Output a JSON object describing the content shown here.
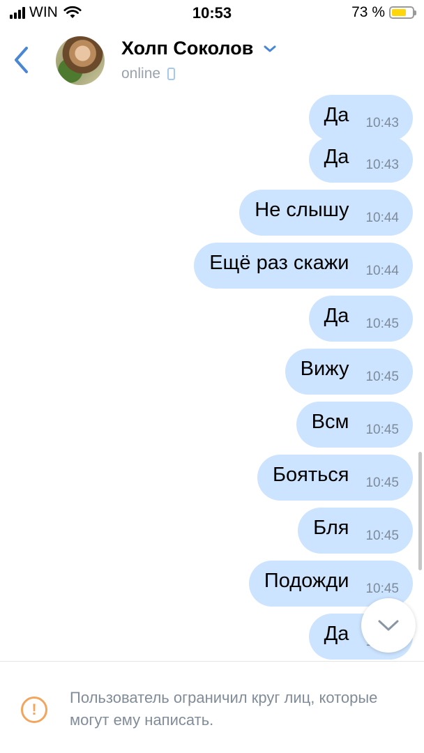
{
  "status_bar": {
    "carrier": "WIN",
    "time": "10:53",
    "battery_percent": "73 %",
    "battery_level": 0.73
  },
  "header": {
    "contact_name": "Холп Соколов",
    "status": "online"
  },
  "messages": [
    {
      "text": "Да",
      "time": "10:43"
    },
    {
      "text": "Да",
      "time": "10:43"
    },
    {
      "text": "Не слышу",
      "time": "10:44"
    },
    {
      "text": "Ещё раз скажи",
      "time": "10:44"
    },
    {
      "text": "Да",
      "time": "10:45"
    },
    {
      "text": "Вижу",
      "time": "10:45"
    },
    {
      "text": "Всм",
      "time": "10:45"
    },
    {
      "text": "Бояться",
      "time": "10:45"
    },
    {
      "text": "Бля",
      "time": "10:45"
    },
    {
      "text": "Подожди",
      "time": "10:45"
    },
    {
      "text": "Да",
      "time": "10:45"
    }
  ],
  "footer": {
    "notice": "Пользователь ограничил круг лиц, которые могут ему написать."
  },
  "colors": {
    "accent": "#4a86d6",
    "bubble_outgoing": "#cce4ff",
    "warning": "#f2a55c"
  }
}
